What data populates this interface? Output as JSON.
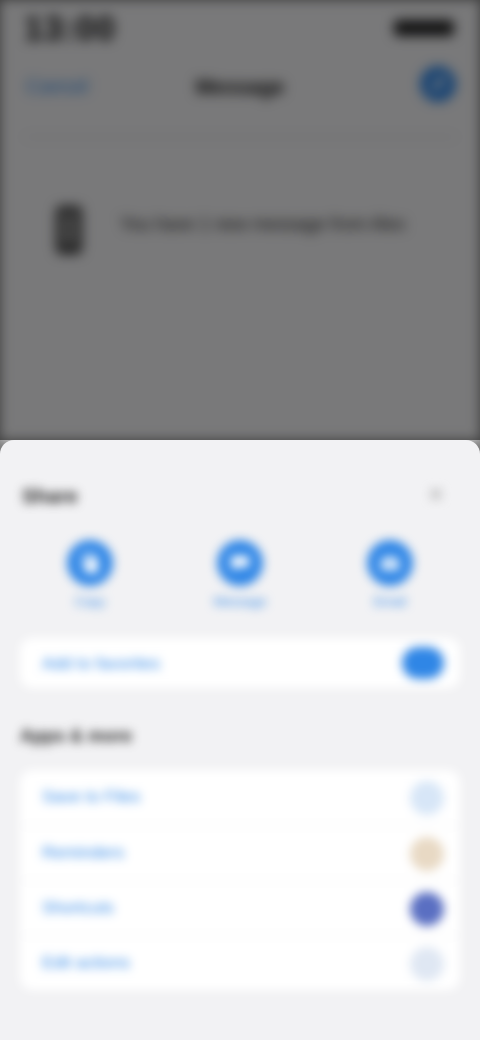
{
  "status_bar": {
    "time": "13:00"
  },
  "nav": {
    "left_label": "Cancel",
    "title": "Message"
  },
  "message": {
    "text": "You have 1 new message from Alex"
  },
  "sheet": {
    "title": "Share",
    "actions": [
      {
        "label": "Copy",
        "icon": "copy-icon"
      },
      {
        "label": "Message",
        "icon": "chat-icon"
      },
      {
        "label": "Email",
        "icon": "mail-icon"
      }
    ],
    "primary_row": {
      "label": "Add to favorites"
    },
    "section_title": "Apps & more",
    "rows": [
      {
        "label": "Save to Files",
        "badge_color": "#d7e6f7"
      },
      {
        "label": "Reminders",
        "badge_color": "#e8d9c4"
      },
      {
        "label": "Shortcuts",
        "badge_color": "#5a6fc2"
      },
      {
        "label": "Edit actions",
        "badge_color": "#dfe7f3"
      }
    ]
  },
  "colors": {
    "accent": "#2f86e6",
    "sheet_bg": "#f2f2f4"
  }
}
